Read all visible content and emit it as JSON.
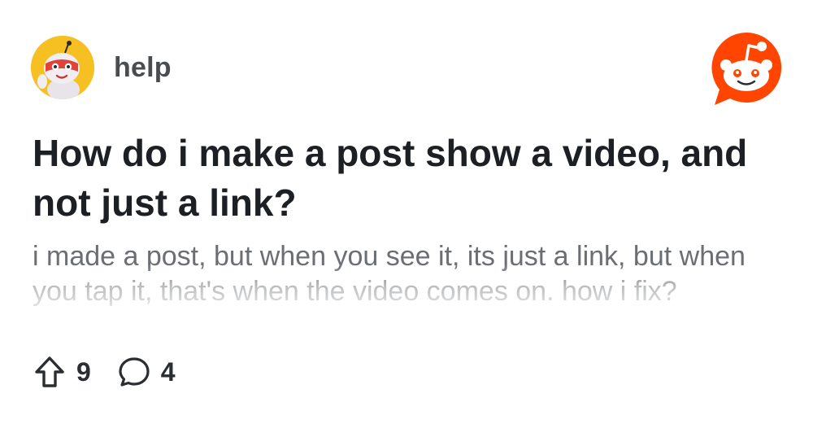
{
  "post": {
    "subreddit": "help",
    "title": "How do i make a post show a video, and not just a link?",
    "body": "i made a post, but when you see it, its just a link, but when you tap it, that's when the video comes on. how i fix?",
    "upvotes": "9",
    "comments": "4"
  },
  "icons": {
    "avatar": "subreddit-mascot-avatar",
    "logo": "reddit-logo-icon",
    "upvote": "upvote-arrow-icon",
    "comment": "comment-bubble-icon"
  },
  "colors": {
    "brand": "#ff4500",
    "avatar_bg": "#f6c023",
    "title": "#1c1f23",
    "body": "#6b6e72"
  }
}
